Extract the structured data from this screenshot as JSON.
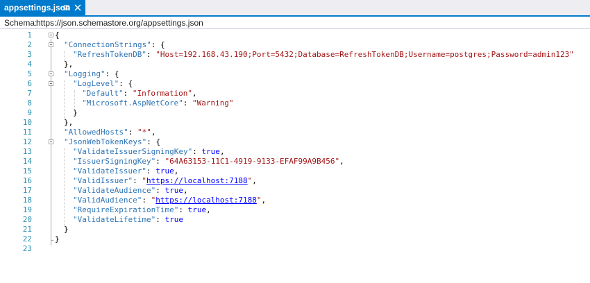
{
  "tab": {
    "title": "appsettings.json",
    "pin_icon": "pin-icon",
    "close_icon": "close-icon"
  },
  "schema": {
    "label": "Schema:",
    "url": "https://json.schemastore.org/appsettings.json"
  },
  "editor": {
    "line_numbers": [
      "1",
      "2",
      "3",
      "4",
      "5",
      "6",
      "7",
      "8",
      "9",
      "10",
      "11",
      "12",
      "13",
      "14",
      "15",
      "16",
      "17",
      "18",
      "19",
      "20",
      "21",
      "22",
      "23"
    ],
    "t": {
      "open": "{",
      "close": "}",
      "close_comma": "},",
      "colon_brace": ": {",
      "colon_space": ": ",
      "comma": ",",
      "connection_strings_key": "\"ConnectionStrings\"",
      "refresh_token_db_key": "\"RefreshTokenDB\"",
      "refresh_token_db_value": "\"Host=192.168.43.190;Port=5432;Database=RefreshTokenDB;Username=postgres;Password=admin123\"",
      "logging_key": "\"Logging\"",
      "log_level_key": "\"LogLevel\"",
      "default_key": "\"Default\"",
      "default_value": "\"Information\"",
      "aspnetcore_key": "\"Microsoft.AspNetCore\"",
      "aspnetcore_value": "\"Warning\"",
      "allowed_hosts_key": "\"AllowedHosts\"",
      "allowed_hosts_value": "\"*\"",
      "jwt_keys_key": "\"JsonWebTokenKeys\"",
      "validate_issuer_signing_key_key": "\"ValidateIssuerSigningKey\"",
      "issuer_signing_key_key": "\"IssuerSigningKey\"",
      "issuer_signing_key_value": "\"64A63153-11C1-4919-9133-EFAF99A9B456\"",
      "validate_issuer_key": "\"ValidateIssuer\"",
      "valid_issuer_key": "\"ValidIssuer\"",
      "quote": "\"",
      "valid_issuer_url": "https://localhost:7188",
      "validate_audience_key": "\"ValidateAudience\"",
      "valid_audience_key": "\"ValidAudience\"",
      "valid_audience_url": "https://localhost:7188",
      "require_expiration_time_key": "\"RequireExpirationTime\"",
      "validate_lifetime_key": "\"ValidateLifetime\"",
      "true": "true"
    }
  }
}
